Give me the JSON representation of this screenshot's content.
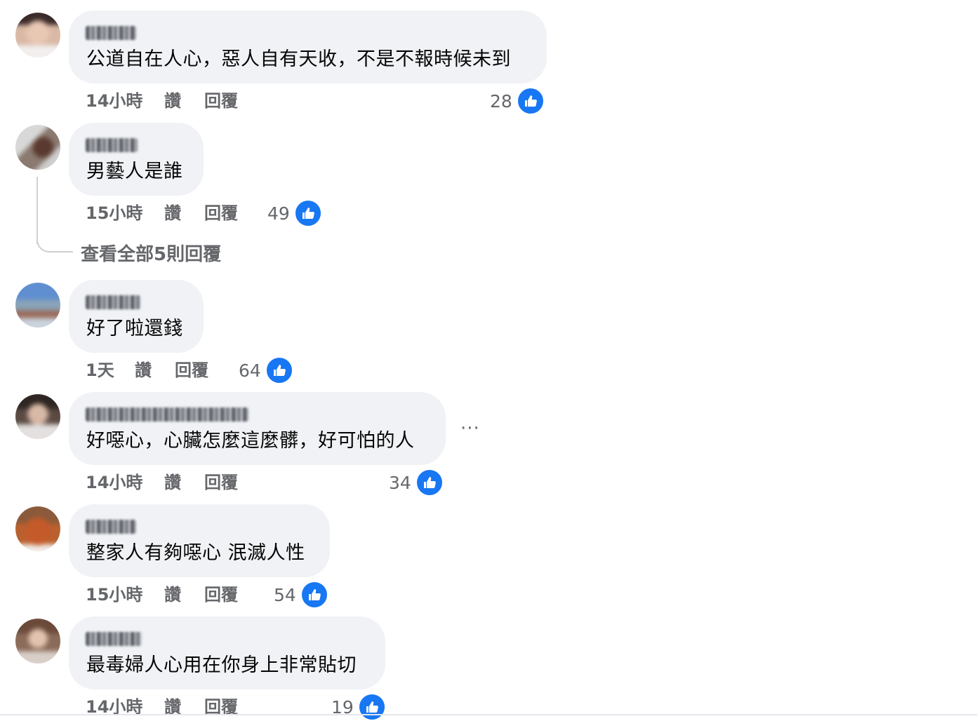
{
  "actions": {
    "like": "讚",
    "reply": "回覆"
  },
  "view_replies": "查看全部5則回覆",
  "more_options": "···",
  "like_color": "#1877f2",
  "comments": [
    {
      "text": "公道自在人心，惡人自有天收，不是不報時候未到",
      "time": "14小時",
      "likes": "28"
    },
    {
      "text": "男藝人是誰",
      "time": "15小時",
      "likes": "49"
    },
    {
      "text": "好了啦還錢",
      "time": "1天",
      "likes": "64"
    },
    {
      "text": "好噁心，心臟怎麼這麼髒，好可怕的人",
      "time": "14小時",
      "likes": "34"
    },
    {
      "text": "整家人有夠噁心 泯滅人性",
      "time": "15小時",
      "likes": "54"
    },
    {
      "text": "最毒婦人心用在你身上非常貼切",
      "time": "14小時",
      "likes": "19"
    }
  ]
}
